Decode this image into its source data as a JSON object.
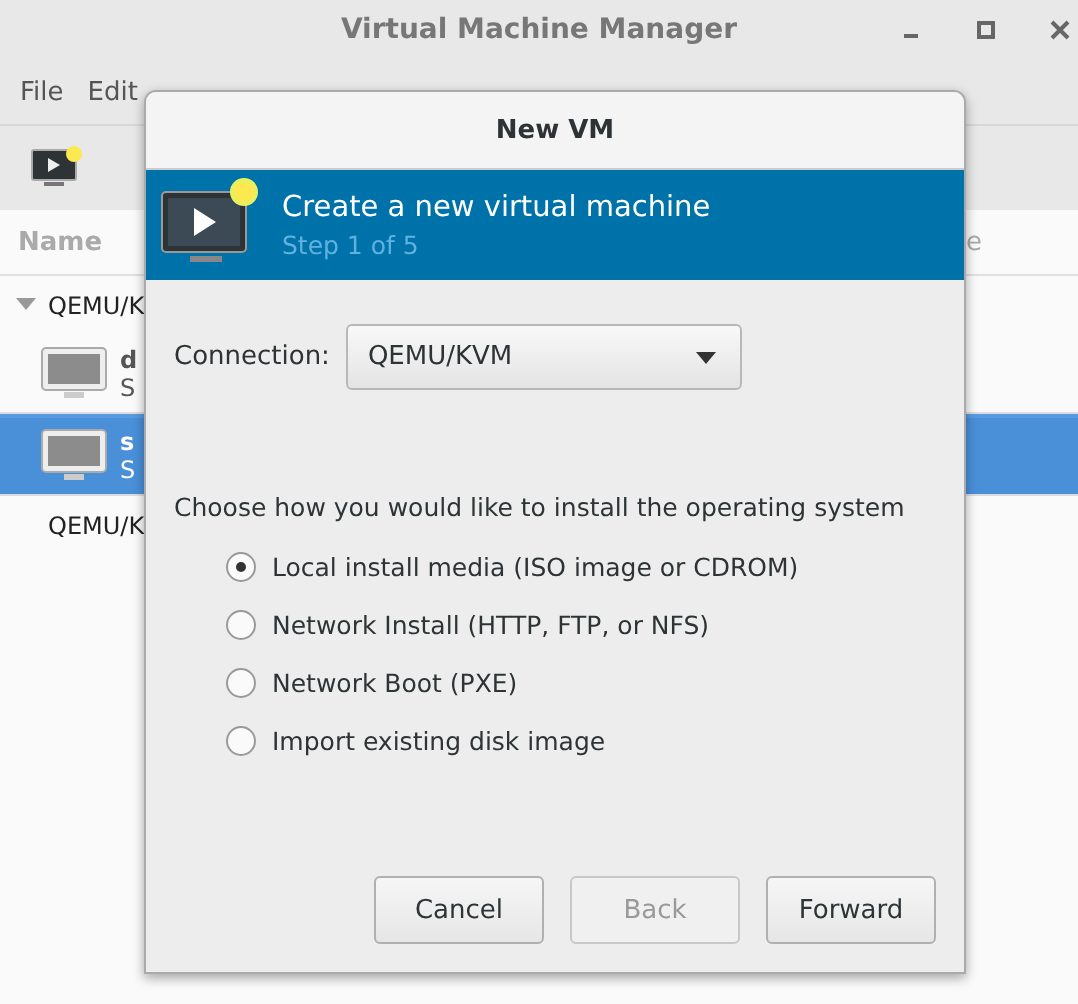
{
  "window": {
    "title": "Virtual Machine Manager"
  },
  "menu": [
    "File",
    "Edit"
  ],
  "list": {
    "columns": [
      "Name",
      "e"
    ],
    "groups": [
      {
        "label": "QEMU/K",
        "expanded": true,
        "vms": [
          {
            "name": "d",
            "status": "S",
            "selected": false
          },
          {
            "name": "s",
            "status": "S",
            "selected": true
          }
        ]
      },
      {
        "label": "QEMU/K",
        "expanded": false
      }
    ]
  },
  "dialog": {
    "title": "New VM",
    "heading": "Create a new virtual machine",
    "step": "Step 1 of 5",
    "connection": {
      "label": "Connection:",
      "value": "QEMU/KVM"
    },
    "prompt": "Choose how you would like to install the operating system",
    "options": [
      {
        "label": "Local install media (ISO image or CDROM)",
        "selected": true
      },
      {
        "label": "Network Install (HTTP, FTP, or NFS)",
        "selected": false
      },
      {
        "label": "Network Boot (PXE)",
        "selected": false
      },
      {
        "label": "Import existing disk image",
        "selected": false
      }
    ],
    "buttons": [
      {
        "label": "Cancel",
        "disabled": false
      },
      {
        "label": "Back",
        "disabled": true
      },
      {
        "label": "Forward",
        "disabled": false
      }
    ]
  }
}
